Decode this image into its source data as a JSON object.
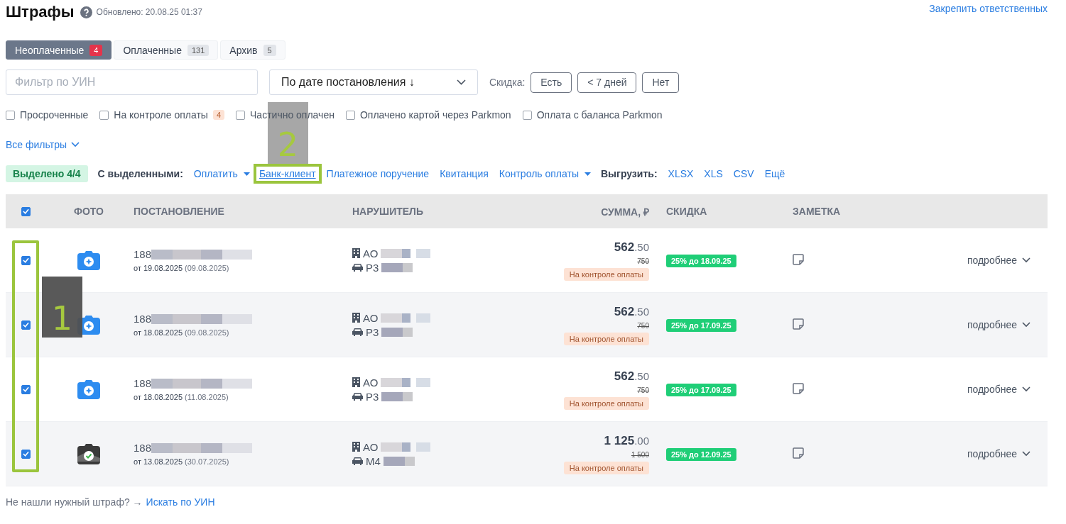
{
  "title": "Штрафы",
  "updated": "Обновлено: 20.08.25 01:37",
  "pin_link": "Закрепить ответственных",
  "tabs": [
    {
      "label": "Неоплаченные",
      "count": "4",
      "selected": true
    },
    {
      "label": "Оплаченные",
      "count": "131",
      "selected": false
    },
    {
      "label": "Архив",
      "count": "5",
      "selected": false
    }
  ],
  "search": {
    "placeholder": "Фильтр по УИН"
  },
  "sort": {
    "value": "По дате постановления ↓"
  },
  "discount": {
    "label": "Скидка:",
    "options": [
      "Есть",
      "< 7 дней",
      "Нет"
    ]
  },
  "filters": [
    {
      "label": "Просроченные",
      "checked": false
    },
    {
      "label": "На контроле оплаты",
      "checked": false,
      "count": "4"
    },
    {
      "label": "Частично оплачен",
      "checked": false
    },
    {
      "label": "Оплачено картой через Parkmon",
      "checked": false
    },
    {
      "label": "Оплата с баланса Parkmon",
      "checked": false
    }
  ],
  "all_filters": "Все фильтры",
  "actions": {
    "selected_badge": "Выделено 4/4",
    "with_selected": "С выделенными:",
    "links": [
      {
        "label": "Оплатить",
        "dropdown": true,
        "annotated": false
      },
      {
        "label": "Банк-клиент",
        "dropdown": false,
        "annotated": true
      },
      {
        "label": "Платежное поручение",
        "dropdown": false,
        "annotated": false
      },
      {
        "label": "Квитанция",
        "dropdown": false,
        "annotated": false
      },
      {
        "label": "Контроль оплаты",
        "dropdown": true,
        "annotated": false
      }
    ],
    "export_label": "Выгрузить:",
    "export_links": [
      "XLSX",
      "XLS",
      "CSV",
      "Ещё"
    ]
  },
  "table": {
    "all_checked": true,
    "columns": [
      "ФОТО",
      "ПОСТАНОВЛЕНИЕ",
      "НАРУШИТЕЛЬ",
      "СУММА, ₽",
      "СКИДКА",
      "ЗАМЕТКА"
    ],
    "rows": [
      {
        "selected": true,
        "kind": "camera",
        "number": "188",
        "date": "от 19.08.2025",
        "date2": "(09.08.2025)",
        "org": "АО",
        "plate": "Р3",
        "amount": "562",
        "fraction": ".50",
        "old": "750",
        "status": "На контроле оплаты",
        "discount": "25% до 18.09.25",
        "more": "подробнее"
      },
      {
        "selected": true,
        "kind": "camera",
        "number": "188",
        "date": "от 18.08.2025",
        "date2": "(09.08.2025)",
        "org": "АО",
        "plate": "Р3",
        "amount": "562",
        "fraction": ".50",
        "old": "750",
        "status": "На контроле оплаты",
        "discount": "25% до 17.09.25",
        "more": "подробнее"
      },
      {
        "selected": true,
        "kind": "camera",
        "number": "188",
        "date": "от 18.08.2025",
        "date2": "(11.08.2025)",
        "org": "АО",
        "plate": "Р3",
        "amount": "562",
        "fraction": ".50",
        "old": "750",
        "status": "На контроле оплаты",
        "discount": "25% до 17.09.25",
        "more": "подробнее"
      },
      {
        "selected": true,
        "kind": "thumbnail",
        "number": "188",
        "date": "от 13.08.2025",
        "date2": "(30.07.2025)",
        "org": "АО",
        "plate": "М4",
        "amount": "1 125",
        "fraction": ".00",
        "old": "1 500",
        "status": "На контроле оплаты",
        "discount": "25% до 12.09.25",
        "more": "подробнее"
      }
    ]
  },
  "footer": {
    "text": "Не нашли нужный штраф? →",
    "link": "Искать по УИН"
  },
  "annotations": [
    {
      "number": "1"
    },
    {
      "number": "2"
    }
  ]
}
